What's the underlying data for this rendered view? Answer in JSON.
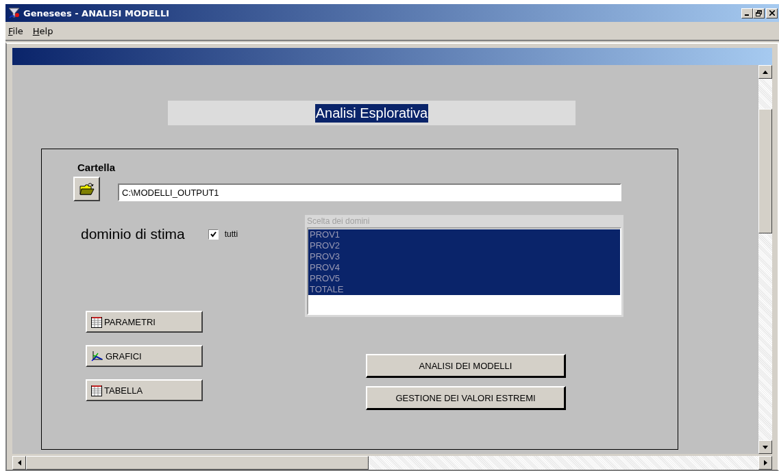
{
  "window": {
    "title": "Genesees - ANALISI MODELLI"
  },
  "menu": [
    {
      "label": "File"
    },
    {
      "label": "Help"
    }
  ],
  "section_title": "Analisi Esplorativa",
  "folder": {
    "label": "Cartella",
    "path": "C:\\MODELLI_OUTPUT1"
  },
  "domain": {
    "label": "dominio di stima",
    "all": {
      "label": "tutti",
      "checked": true
    }
  },
  "domain_list": {
    "header": "Scelta dei domini",
    "disabled": true,
    "items": [
      {
        "label": "PROV1",
        "selected": true
      },
      {
        "label": "PROV2",
        "selected": true
      },
      {
        "label": "PROV3",
        "selected": true
      },
      {
        "label": "PROV4",
        "selected": true
      },
      {
        "label": "PROV5",
        "selected": true
      },
      {
        "label": "TOTALE",
        "selected": true
      }
    ]
  },
  "tool_buttons": [
    {
      "label": "PARAMETRI",
      "kind": "table"
    },
    {
      "label": "GRAFICI",
      "kind": "chart"
    },
    {
      "label": "TABELLA",
      "kind": "table"
    }
  ],
  "action_buttons": [
    {
      "label": "ANALISI DEI MODELLI"
    },
    {
      "label": "GESTIONE DEI VALORI ESTREMI"
    }
  ]
}
